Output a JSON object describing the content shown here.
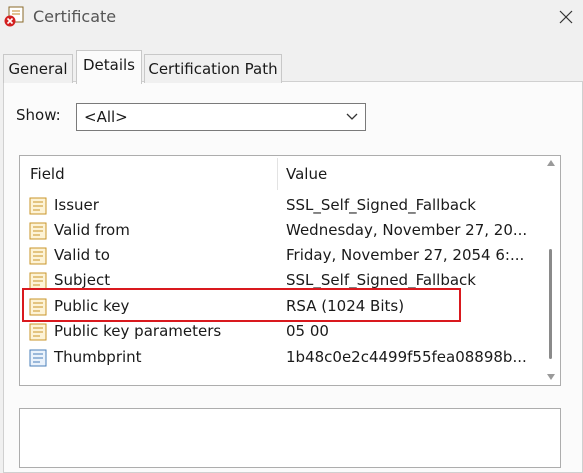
{
  "window": {
    "title": "Certificate"
  },
  "icons": {
    "app": "certificate-error-icon",
    "close": "close-icon",
    "field": "certificate-field-icon",
    "thumbprint": "thumbprint-icon",
    "dropdown": "chevron-down-icon"
  },
  "tabs": [
    {
      "label": "General",
      "active": false
    },
    {
      "label": "Details",
      "active": true
    },
    {
      "label": "Certification Path",
      "active": false
    }
  ],
  "show": {
    "label": "Show:",
    "value": "<All>"
  },
  "list": {
    "columns": [
      "Field",
      "Value"
    ],
    "rows": [
      {
        "field": "Issuer",
        "value": "SSL_Self_Signed_Fallback"
      },
      {
        "field": "Valid from",
        "value": "Wednesday, November 27, 20..."
      },
      {
        "field": "Valid to",
        "value": "Friday, November 27, 2054 6:..."
      },
      {
        "field": "Subject",
        "value": "SSL_Self_Signed_Fallback"
      },
      {
        "field": "Public key",
        "value": "RSA (1024 Bits)"
      },
      {
        "field": "Public key parameters",
        "value": "05 00"
      },
      {
        "field": "Thumbprint",
        "value": "1b48c0e2c4499f55fea08898b..."
      }
    ],
    "highlighted_row": "Public key",
    "highlight_color": "#d9191e"
  }
}
